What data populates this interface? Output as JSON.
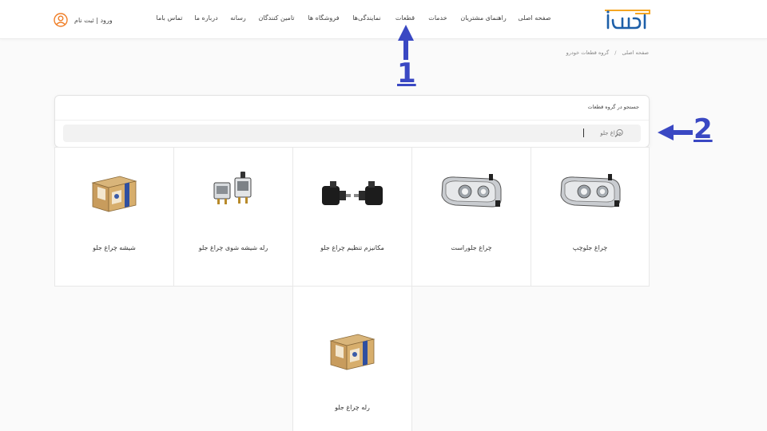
{
  "header": {
    "logo_text": "ایساکو",
    "nav": [
      {
        "label": "صفحه اصلی"
      },
      {
        "label": "راهنمای مشتریان"
      },
      {
        "label": "خدمات"
      },
      {
        "label": "قطعات"
      },
      {
        "label": "نمایندگی‌ها"
      },
      {
        "label": "فروشگاه ها"
      },
      {
        "label": "تامین کنندگان"
      },
      {
        "label": "رسانه"
      },
      {
        "label": "درباره ما"
      },
      {
        "label": "تماس باما"
      }
    ],
    "login_label": "ورود | ثبت نام",
    "login_icon": "user-circle-icon",
    "accent_color": "#f07e26",
    "brand_color": "#1d5fa8"
  },
  "breadcrumb": {
    "home": "صفحه اصلی",
    "separator": "/",
    "current": "گروه قطعات خودرو"
  },
  "search": {
    "title": "جستجو در گروه قطعات",
    "value": "چراغ جلو",
    "icon": "search-icon"
  },
  "products": [
    {
      "name": "چراغ جلوچپ",
      "image": "headlight-image"
    },
    {
      "name": "چراغ جلوراست",
      "image": "headlight-image"
    },
    {
      "name": "مکانیزم تنظیم چراغ جلو",
      "image": "headlight-adjuster-image"
    },
    {
      "name": "رله شیشه شوی چراغ جلو",
      "image": "relay-image"
    },
    {
      "name": "شیشه چراغ جلو",
      "image": "box-image"
    },
    {
      "name": "رله چراغ جلو",
      "image": "box-image"
    }
  ],
  "annotations": [
    {
      "number": "1",
      "direction": "up",
      "color": "#3a48c3"
    },
    {
      "number": "2",
      "direction": "left",
      "color": "#3a48c3"
    }
  ]
}
